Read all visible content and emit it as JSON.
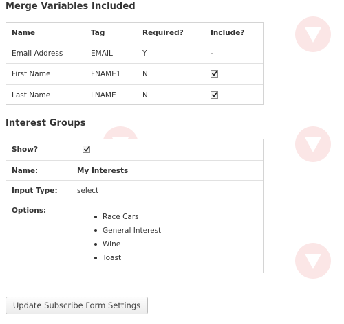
{
  "merge": {
    "title": "Merge Variables Included",
    "headers": [
      "Name",
      "Tag",
      "Required?",
      "Include?"
    ],
    "rows": [
      {
        "name": "Email Address",
        "tag": "EMAIL",
        "required": "Y",
        "include_text": "-",
        "include_checked": false
      },
      {
        "name": "First Name",
        "tag": "FNAME1",
        "required": "N",
        "include_text": "",
        "include_checked": true
      },
      {
        "name": "Last Name",
        "tag": "LNAME",
        "required": "N",
        "include_text": "",
        "include_checked": true
      }
    ]
  },
  "interest": {
    "title": "Interest Groups",
    "show_label": "Show?",
    "show_checked": true,
    "name_label": "Name:",
    "name_value": "My Interests",
    "input_type_label": "Input Type:",
    "input_type_value": "select",
    "options_label": "Options:",
    "options": [
      "Race Cars",
      "General Interest",
      "Wine",
      "Toast"
    ]
  },
  "actions": {
    "update_label": "Update Subscribe Form Settings"
  },
  "colors": {
    "border": "#d4d4d4",
    "text": "#333333",
    "watermark": "#e23b3b"
  }
}
